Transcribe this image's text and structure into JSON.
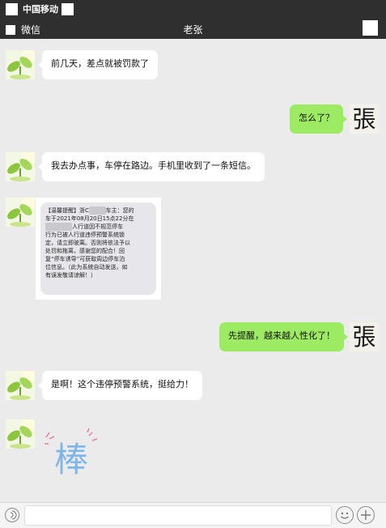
{
  "status_bar": {
    "carrier": "中国移动"
  },
  "nav": {
    "back_label": "微信",
    "title": "老张"
  },
  "contact_avatar_char": "張",
  "messages": [
    {
      "side": "left",
      "text": "前几天，差点就被罚款了"
    },
    {
      "side": "right",
      "text": "怎么了？"
    },
    {
      "side": "left",
      "text": "我去办点事，车停在路边。手机里收到了一条短信。"
    },
    {
      "side": "left",
      "type": "image"
    },
    {
      "side": "right",
      "text": "先提醒，越来越人性化了！"
    },
    {
      "side": "left",
      "text": "是啊！这个违停预警系统，挺给力！"
    },
    {
      "side": "left",
      "type": "sticker"
    }
  ],
  "sms": {
    "line1": "【温馨提醒】浙C",
    "line1b": "车主：您的",
    "line2": "车于2021年08月20日15点22分在",
    "line3": "人行道因不规范停车",
    "line4": "行为已被人行道违停预警系统锁",
    "line5": "定，请立即驶离。否则将依法予以",
    "line6": "处罚和拖离，感谢您的配合！回",
    "line7": "复“停车诱导”可获取周边停车泊",
    "line8": "位信息。（此为系统自动发送，如",
    "line9": "有误发敬请谅解！）"
  },
  "sticker": {
    "text": "棒",
    "color": "#7fb6ea"
  },
  "colors": {
    "bubble_right": "#9deb63",
    "bubble_left": "#ffffff",
    "background": "#ebebeb",
    "bar": "#2f2f2f"
  }
}
